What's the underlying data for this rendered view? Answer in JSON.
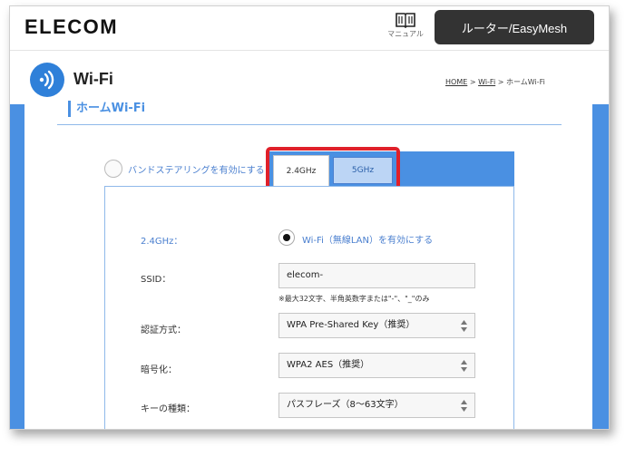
{
  "header": {
    "logo": "ELECOM",
    "manual_label": "マニュアル",
    "router_button": "ルーター/EasyMesh"
  },
  "page": {
    "title": "Wi-Fi",
    "breadcrumb": {
      "home": "HOME",
      "sep1": " > ",
      "wifi": "Wi-Fi",
      "sep2": " > ",
      "current": "ホームWi-Fi"
    }
  },
  "section": {
    "title": "ホームWi-Fi"
  },
  "band_steering": {
    "label": "バンドステアリングを有効にする",
    "checked": false
  },
  "tabs": [
    {
      "label": "2.4GHz",
      "active": true
    },
    {
      "label": "5GHz",
      "active": false
    }
  ],
  "form": {
    "band_label": "2.4GHz：",
    "wifi_enable_label": "Wi-Fi（無線LAN）を有効にする",
    "ssid_label": "SSID：",
    "ssid_value": "elecom-",
    "ssid_note": "※最大32文字、半角英数字または\"-\"、\"_\"のみ",
    "auth_label": "認証方式：",
    "auth_value": "WPA Pre-Shared Key（推奨）",
    "encryption_label": "暗号化：",
    "encryption_value": "WPA2 AES（推奨）",
    "key_type_label": "キーの種類：",
    "key_type_value": "パスフレーズ（8〜63文字）"
  },
  "colors": {
    "accent": "#4a90e2",
    "highlight": "#e0202a",
    "dark_button": "#333333"
  },
  "icons": {
    "manual": "book-icon",
    "wifi": "wifi-icon",
    "select": "updown-arrow-icon"
  }
}
